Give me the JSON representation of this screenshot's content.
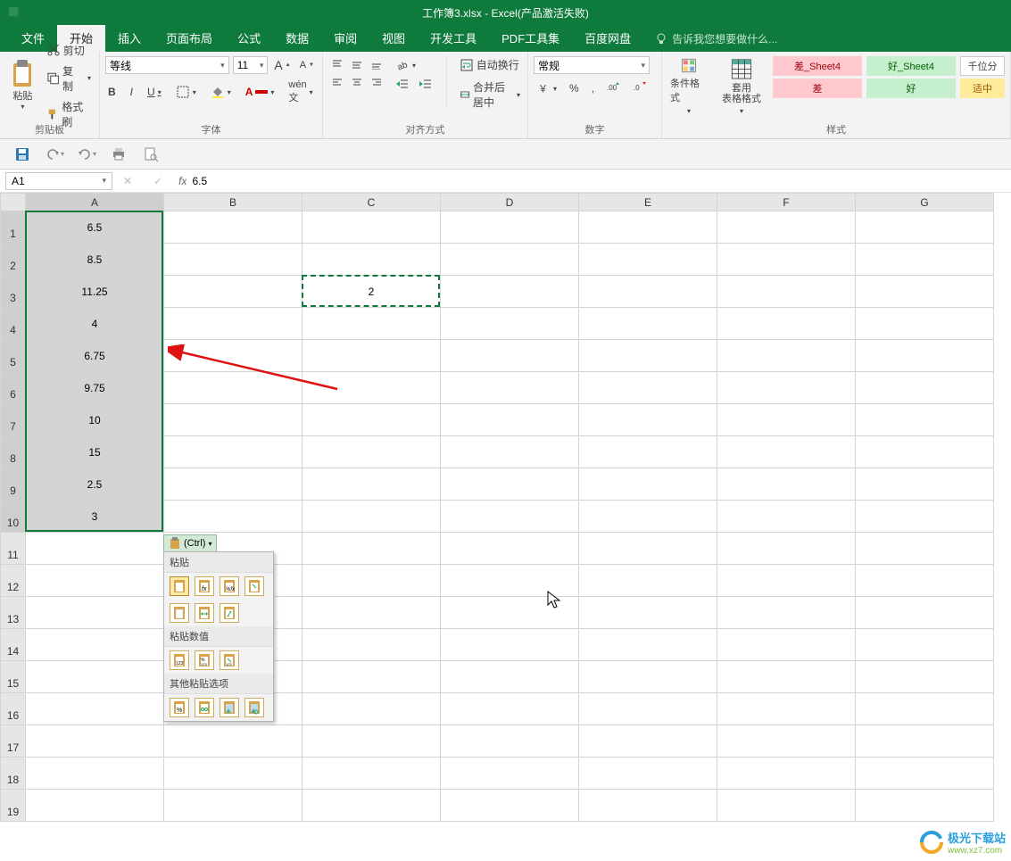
{
  "title": "工作簿3.xlsx - Excel(产品激活失败)",
  "menus": [
    "文件",
    "开始",
    "插入",
    "页面布局",
    "公式",
    "数据",
    "审阅",
    "视图",
    "开发工具",
    "PDF工具集",
    "百度网盘"
  ],
  "active_menu_index": 1,
  "tell_me": "告诉我您想要做什么...",
  "ribbon": {
    "clipboard": {
      "paste": "粘贴",
      "cut": "剪切",
      "copy": "复制",
      "format_painter": "格式刷",
      "label": "剪贴板"
    },
    "font": {
      "name": "等线",
      "size": "11",
      "increase": "A",
      "decrease": "A",
      "bold": "B",
      "italic": "I",
      "underline": "U",
      "label": "字体"
    },
    "alignment": {
      "wrap": "自动换行",
      "merge": "合并后居中",
      "label": "对齐方式"
    },
    "number": {
      "format": "常规",
      "label": "数字"
    },
    "styles": {
      "cond": "条件格式",
      "table": "套用\n表格格式",
      "cells": [
        [
          "差_Sheet4",
          "好_Sheet4",
          "千位分"
        ],
        [
          "差",
          "好",
          "适中"
        ]
      ],
      "label": "样式"
    }
  },
  "namebox": "A1",
  "formula": "6.5",
  "columns": [
    "A",
    "B",
    "C",
    "D",
    "E",
    "F",
    "G"
  ],
  "rows": [
    {
      "n": 1,
      "A": "6.5"
    },
    {
      "n": 2,
      "A": "8.5"
    },
    {
      "n": 3,
      "A": "11.25",
      "C": "2"
    },
    {
      "n": 4,
      "A": "4"
    },
    {
      "n": 5,
      "A": "6.75"
    },
    {
      "n": 6,
      "A": "9.75"
    },
    {
      "n": 7,
      "A": "10"
    },
    {
      "n": 8,
      "A": "15"
    },
    {
      "n": 9,
      "A": "2.5"
    },
    {
      "n": 10,
      "A": "3"
    },
    {
      "n": 11
    },
    {
      "n": 12
    },
    {
      "n": 13
    },
    {
      "n": 14
    },
    {
      "n": 15
    },
    {
      "n": 16
    },
    {
      "n": 17
    },
    {
      "n": 18
    },
    {
      "n": 19
    }
  ],
  "paste_tag": "(Ctrl)",
  "paste_menu": {
    "paste": "粘贴",
    "values": "粘贴数值",
    "other": "其他粘贴选项"
  },
  "watermark": {
    "brand": "极光下载站",
    "url": "www.xz7.com"
  }
}
